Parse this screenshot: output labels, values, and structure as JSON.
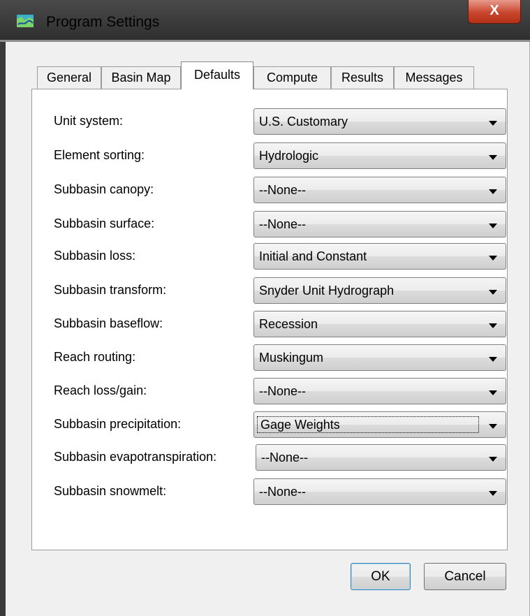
{
  "window": {
    "title": "Program Settings",
    "close_label": "X"
  },
  "tabs": [
    {
      "label": "General"
    },
    {
      "label": "Basin Map"
    },
    {
      "label": "Defaults"
    },
    {
      "label": "Compute"
    },
    {
      "label": "Results"
    },
    {
      "label": "Messages"
    }
  ],
  "active_tab": "Defaults",
  "settings": [
    {
      "label": "Unit system:",
      "value": "U.S. Customary"
    },
    {
      "label": "Element sorting:",
      "value": "Hydrologic"
    },
    {
      "label": "Subbasin canopy:",
      "value": "--None--"
    },
    {
      "label": "Subbasin surface:",
      "value": "--None--"
    },
    {
      "label": "Subbasin loss:",
      "value": "Initial and Constant"
    },
    {
      "label": "Subbasin transform:",
      "value": "Snyder Unit Hydrograph"
    },
    {
      "label": "Subbasin baseflow:",
      "value": "Recession"
    },
    {
      "label": "Reach routing:",
      "value": "Muskingum"
    },
    {
      "label": "Reach loss/gain:",
      "value": "--None--"
    },
    {
      "label": "Subbasin precipitation:",
      "value": "Gage Weights"
    },
    {
      "label": "Subbasin evapotranspiration:",
      "value": "--None--"
    },
    {
      "label": "Subbasin snowmelt:",
      "value": "--None--"
    }
  ],
  "buttons": {
    "ok_label": "OK",
    "cancel_label": "Cancel"
  },
  "colors": {
    "title_bar": "#2e2e2e",
    "close_button": "#c9452d",
    "panel_background": "#ffffff"
  }
}
